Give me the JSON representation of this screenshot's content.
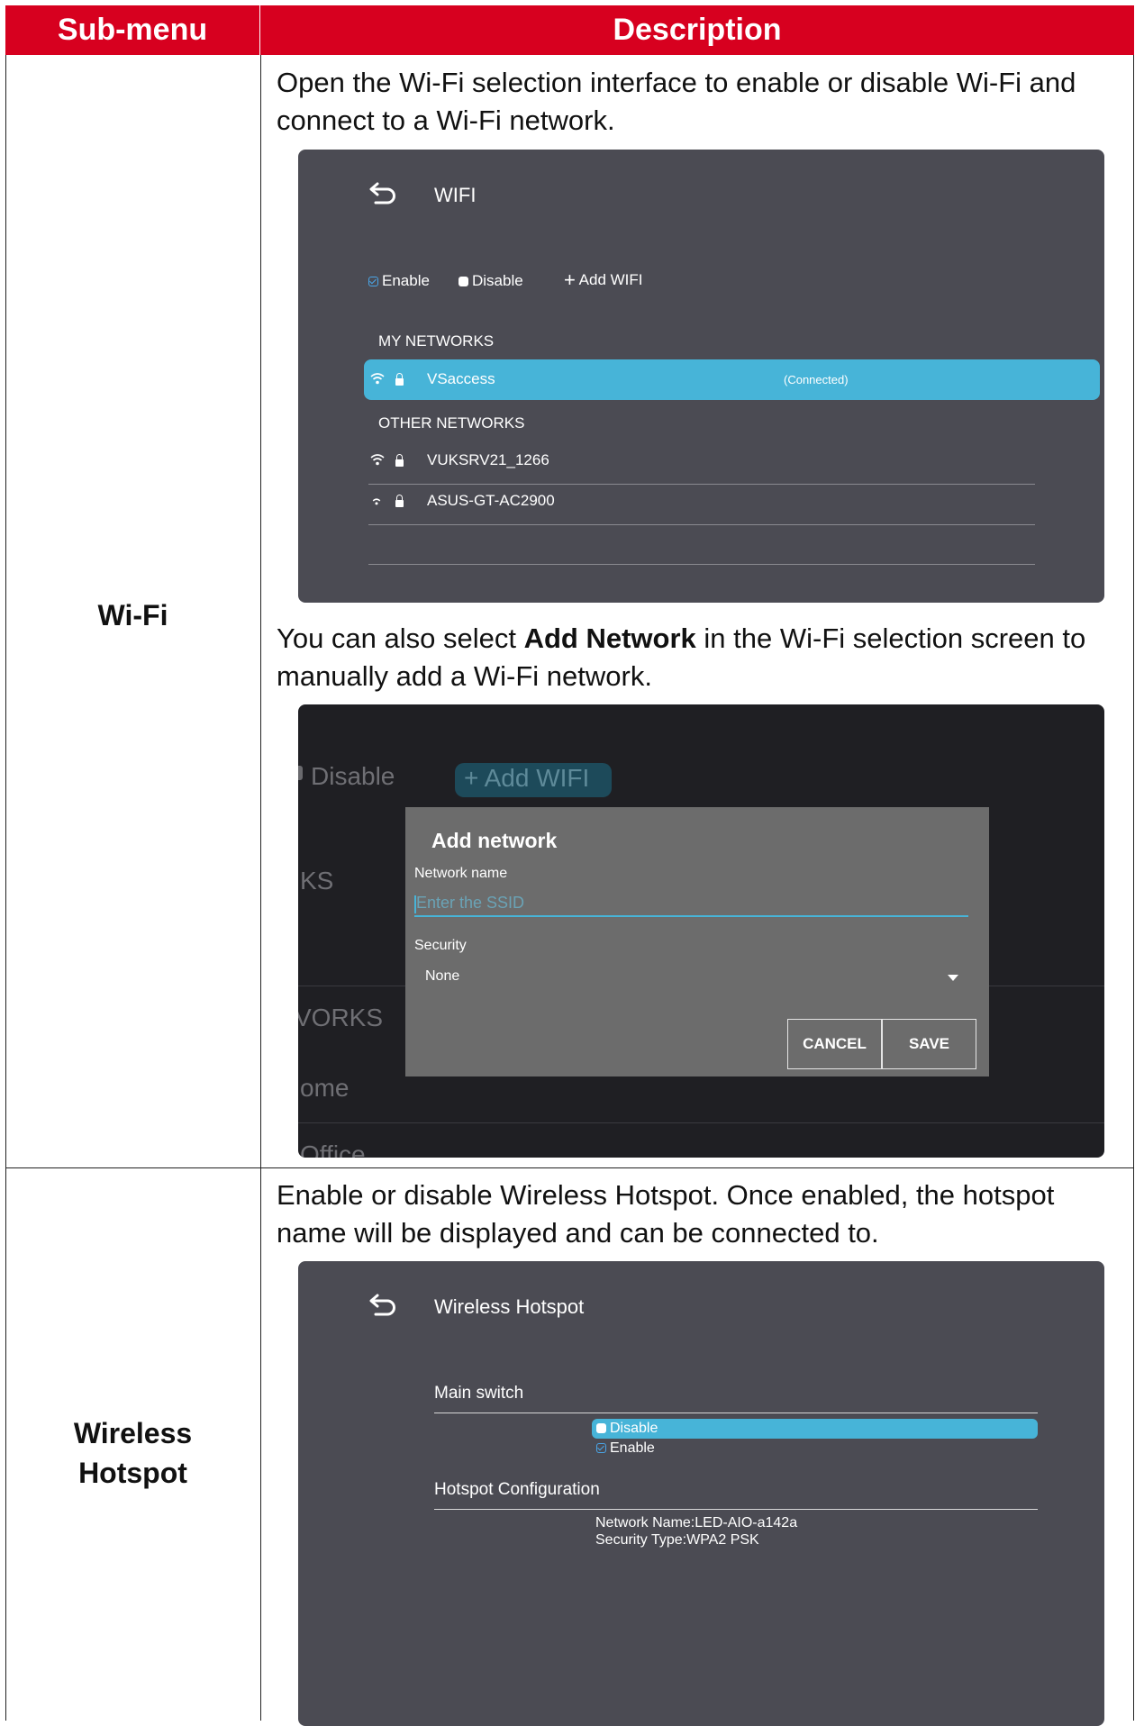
{
  "table": {
    "headers": [
      "Sub-menu",
      "Description"
    ],
    "rows": [
      {
        "label": "Wi-Fi",
        "desc1": "Open the Wi-Fi selection interface to enable or disable Wi-Fi and connect to a Wi-Fi network.",
        "desc2_before": "You can also select ",
        "desc2_bold": "Add Network",
        "desc2_after": " in the Wi-Fi selection screen to manually add a Wi-Fi network."
      },
      {
        "label_line1": "Wireless",
        "label_line2": "Hotspot",
        "desc": "Enable or disable Wireless Hotspot. Once enabled, the hotspot name will be displayed and can be connected to."
      }
    ]
  },
  "wifi_screen": {
    "title": "WIFI",
    "enable_label": "Enable",
    "disable_label": "Disable",
    "add_label": "Add WIFI",
    "my_networks_header": "MY NETWORKS",
    "connected_network": "VSaccess",
    "connected_status": "(Connected)",
    "other_networks_header": "OTHER NETWORKS",
    "other_networks": [
      "VUKSRV21_1266",
      "ASUS-GT-AC2900"
    ]
  },
  "add_network_screen": {
    "bg_disable": "Disable",
    "bg_add": "Add WIFI",
    "bg_ks": "KS",
    "bg_works": "VORKS",
    "bg_home": "ome",
    "bg_office": "Office",
    "dialog_title": "Add network",
    "network_name_label": "Network name",
    "ssid_placeholder": "Enter the SSID",
    "security_label": "Security",
    "security_value": "None",
    "cancel_label": "CANCEL",
    "save_label": "SAVE"
  },
  "hotspot_screen": {
    "title": "Wireless Hotspot",
    "main_switch_label": "Main switch",
    "disable_label": "Disable",
    "enable_label": "Enable",
    "config_label": "Hotspot Configuration",
    "network_name": "Network Name:LED-AIO-a142a",
    "security_type": "Security Type:WPA2 PSK"
  },
  "colors": {
    "header_red": "#d7001f",
    "highlight_blue": "#47b4d8",
    "panel_grey": "#4b4b53"
  }
}
